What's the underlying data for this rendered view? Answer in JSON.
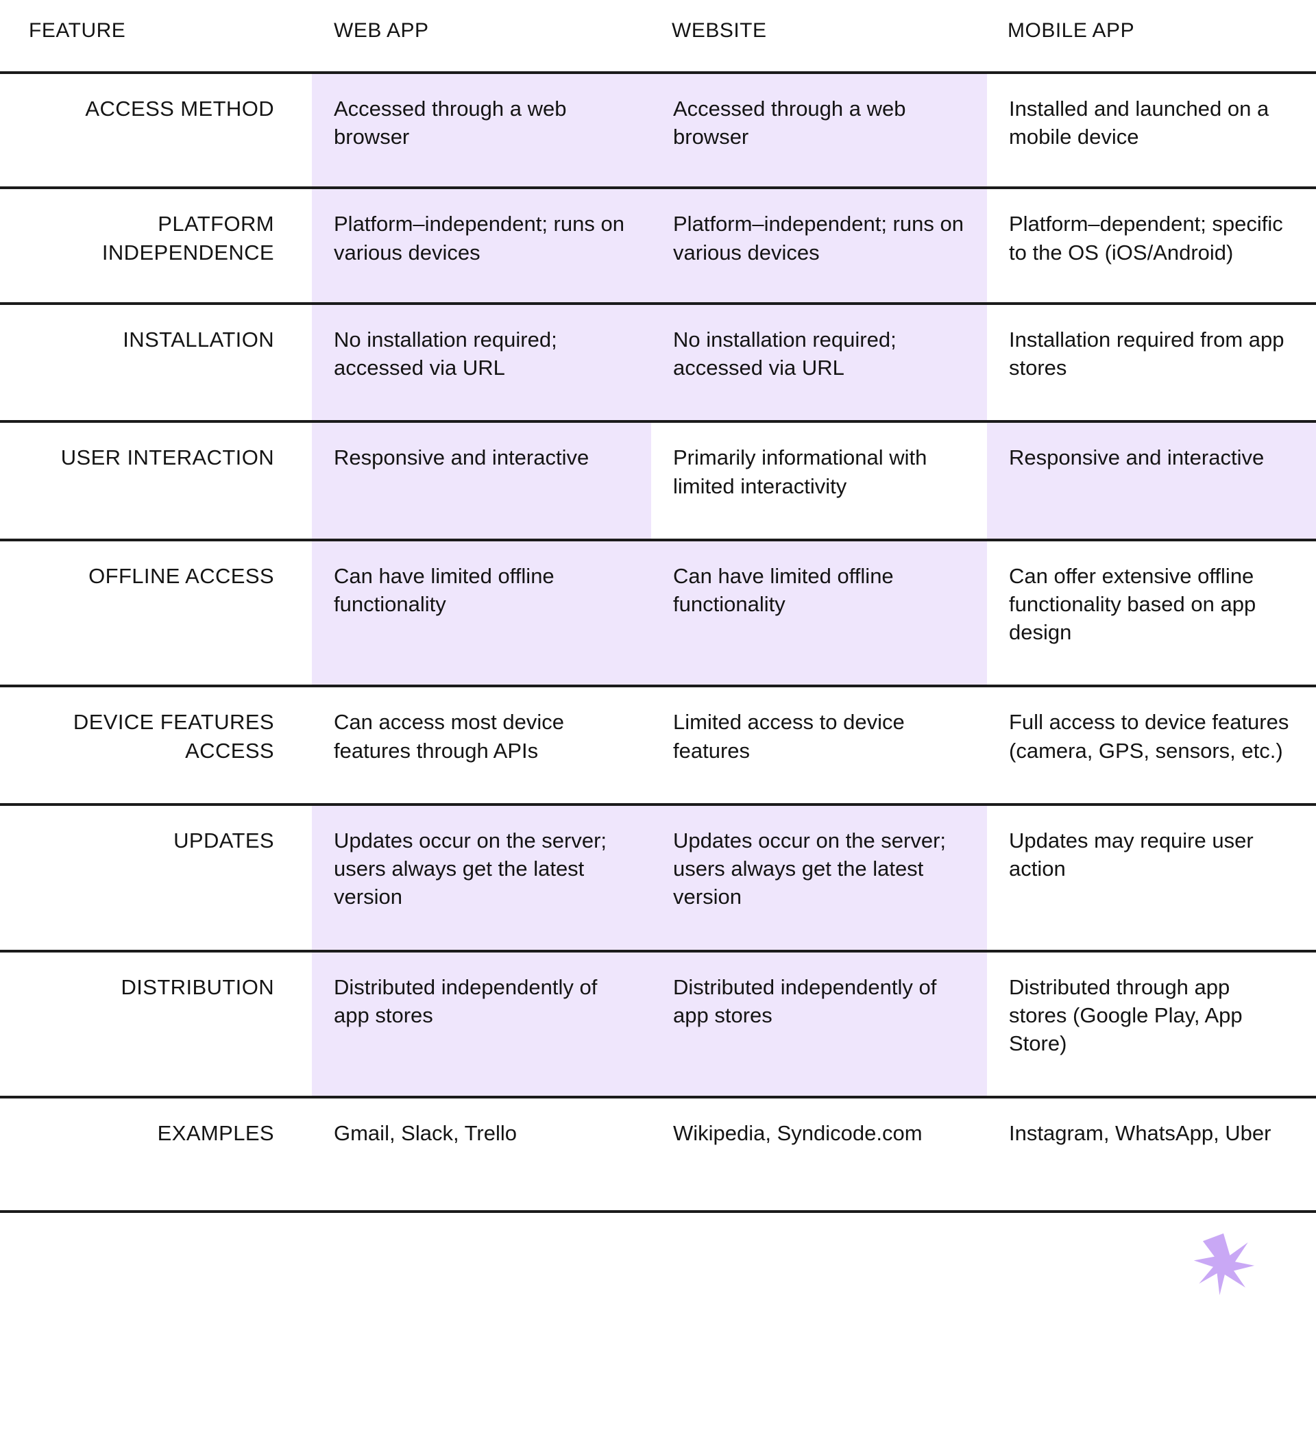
{
  "table": {
    "headers": [
      {
        "id": "feature",
        "label": "FEATURE"
      },
      {
        "id": "web_app",
        "label": "WEB APP"
      },
      {
        "id": "website",
        "label": "WEBSITE"
      },
      {
        "id": "mobile_app",
        "label": "MOBILE APP"
      }
    ],
    "rows": [
      {
        "feature": "ACCESS METHOD",
        "web_app": "Accessed through a web browser",
        "website": "Accessed through a web browser",
        "mobile_app": "Installed and launched on a mobile device",
        "highlighted": [
          "web_app",
          "website"
        ]
      },
      {
        "feature": "PLATFORM\nINDEPENDENCE",
        "web_app": "Platform–independent; runs on various devices",
        "website": "Platform–independent; runs on various devices",
        "mobile_app": "Platform–dependent; specific to the OS (iOS/Android)",
        "highlighted": [
          "web_app",
          "website"
        ]
      },
      {
        "feature": "INSTALLATION",
        "web_app": "No installation required; accessed via URL",
        "website": "No installation required; accessed via URL",
        "mobile_app": "Installation required from app stores",
        "highlighted": [
          "web_app",
          "website"
        ]
      },
      {
        "feature": "USER INTERACTION",
        "web_app": "Responsive and interactive",
        "website": "Primarily informational with limited interactivity",
        "mobile_app": "Responsive and interactive",
        "highlighted": [
          "web_app",
          "mobile_app"
        ]
      },
      {
        "feature": "OFFLINE ACCESS",
        "web_app": "Can have limited offline functionality",
        "website": "Can have limited offline functionality",
        "mobile_app": "Can offer extensive offline functionality based on app design",
        "highlighted": [
          "web_app",
          "website"
        ]
      },
      {
        "feature": "DEVICE FEATURES\nACCESS",
        "web_app": "Can access most device features through APIs",
        "website": "Limited access to device features",
        "mobile_app": "Full access to device features (camera, GPS, sensors, etc.)",
        "highlighted": []
      },
      {
        "feature": "UPDATES",
        "web_app": "Updates occur on the server; users always get the latest version",
        "website": "Updates occur on the server; users always get the latest version",
        "mobile_app": "Updates may require user action",
        "highlighted": [
          "web_app",
          "website"
        ]
      },
      {
        "feature": "DISTRIBUTION",
        "web_app": "Distributed independently of app stores",
        "website": "Distributed independently of app stores",
        "mobile_app": "Distributed through app stores (Google Play, App Store)",
        "highlighted": [
          "web_app",
          "website"
        ]
      },
      {
        "feature": "EXAMPLES",
        "web_app": "Gmail, Slack, Trello",
        "website": "Wikipedia, Syndicode.com",
        "mobile_app": "Instagram, WhatsApp, Uber",
        "highlighted": []
      }
    ]
  },
  "decoration": {
    "asterisk_icon": "asterisk-icon",
    "asterisk_color": "#C9A8F5"
  },
  "colors": {
    "highlight": "#EFE6FC",
    "rule": "#1B1B1B",
    "text": "#141414",
    "background": "#FFFFFF"
  }
}
